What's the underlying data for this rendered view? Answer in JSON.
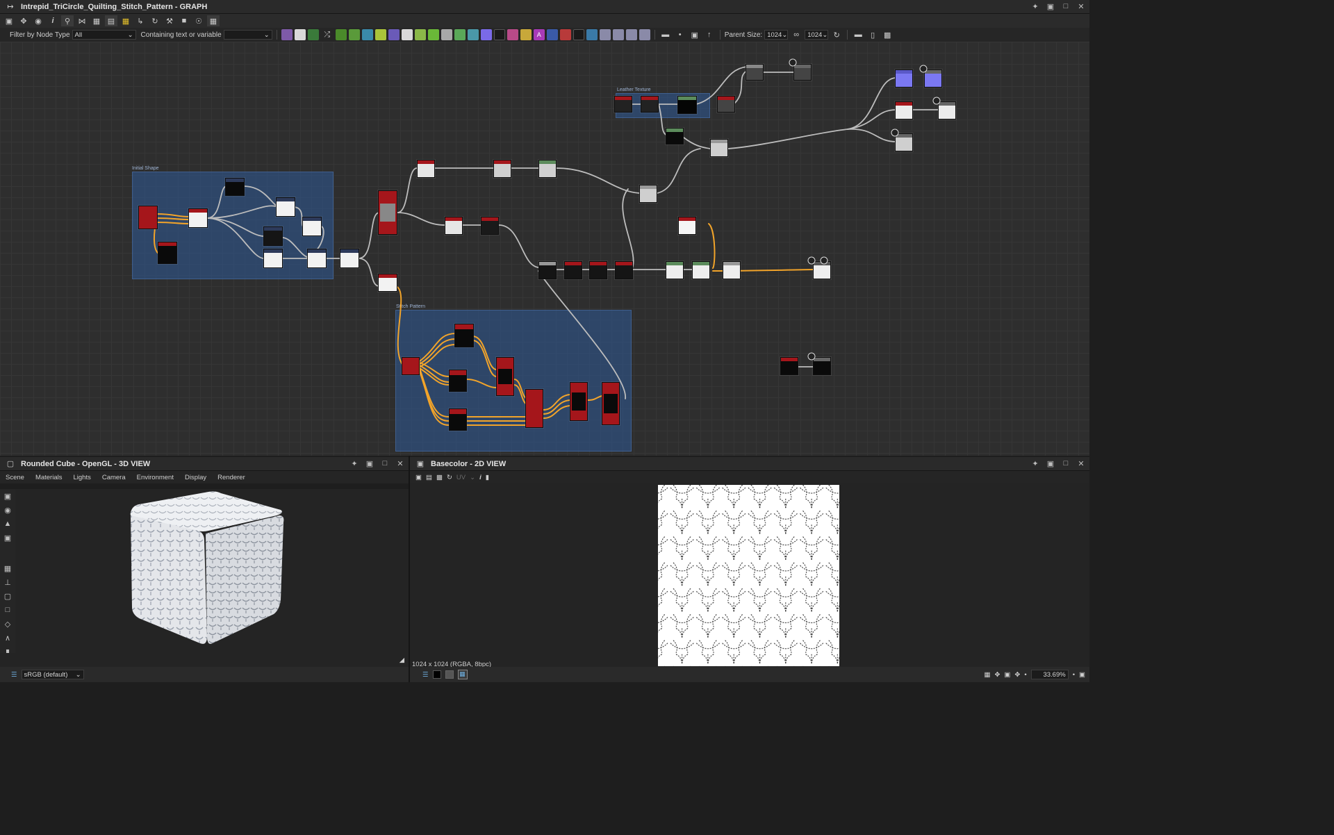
{
  "graph_window": {
    "title": "Intrepid_TriCircle_Quilting_Stitch_Pattern - GRAPH",
    "filter_label": "Filter by Node Type",
    "filter_value": "All",
    "containing_label": "Containing text or variable",
    "containing_value": "",
    "parent_size_label": "Parent Size:",
    "parent_size_w": "1024",
    "parent_size_h": "1024"
  },
  "frames": [
    {
      "label": "Initial Shape"
    },
    {
      "label": "Leather Texture"
    },
    {
      "label": "Stitch Pattern"
    }
  ],
  "view3d": {
    "title": "Rounded Cube - OpenGL - 3D VIEW",
    "menu": [
      "Scene",
      "Materials",
      "Lights",
      "Camera",
      "Environment",
      "Display",
      "Renderer"
    ],
    "colorspace": "sRGB (default)"
  },
  "view2d": {
    "title": "Basecolor - 2D VIEW",
    "uv_label": "UV",
    "image_info": "1024 x 1024 (RGBA, 8bpc)",
    "zoom": "33.69%"
  },
  "colors": {
    "frame": "#2f558c",
    "node_red": "#a5161b",
    "wire_orange": "#f2a42a",
    "wire_gray": "#bdbdbd",
    "purple_node": "#7b78f2"
  }
}
